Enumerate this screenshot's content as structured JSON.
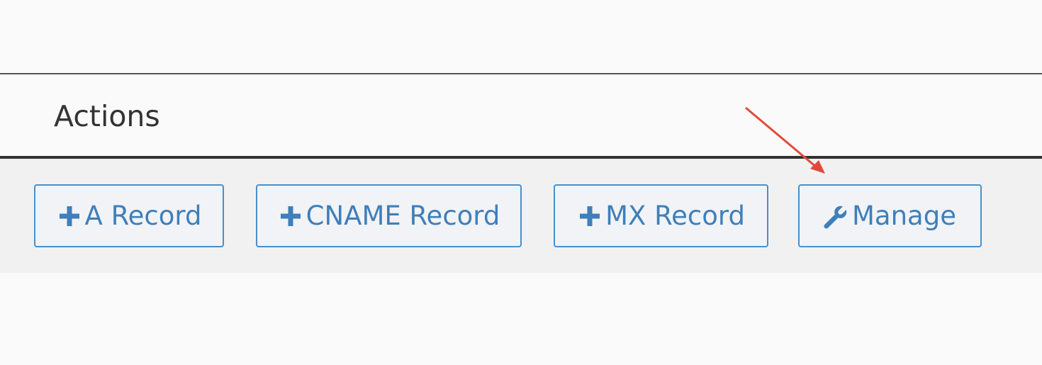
{
  "table": {
    "column_header": "Actions"
  },
  "actions": [
    {
      "label": "A Record",
      "icon": "plus-icon"
    },
    {
      "label": "CNAME Record",
      "icon": "plus-icon"
    },
    {
      "label": "MX Record",
      "icon": "plus-icon"
    },
    {
      "label": "Manage",
      "icon": "wrench-icon"
    }
  ],
  "colors": {
    "button_accent": "#4a90c9",
    "annotation_arrow": "#e04a3a"
  }
}
